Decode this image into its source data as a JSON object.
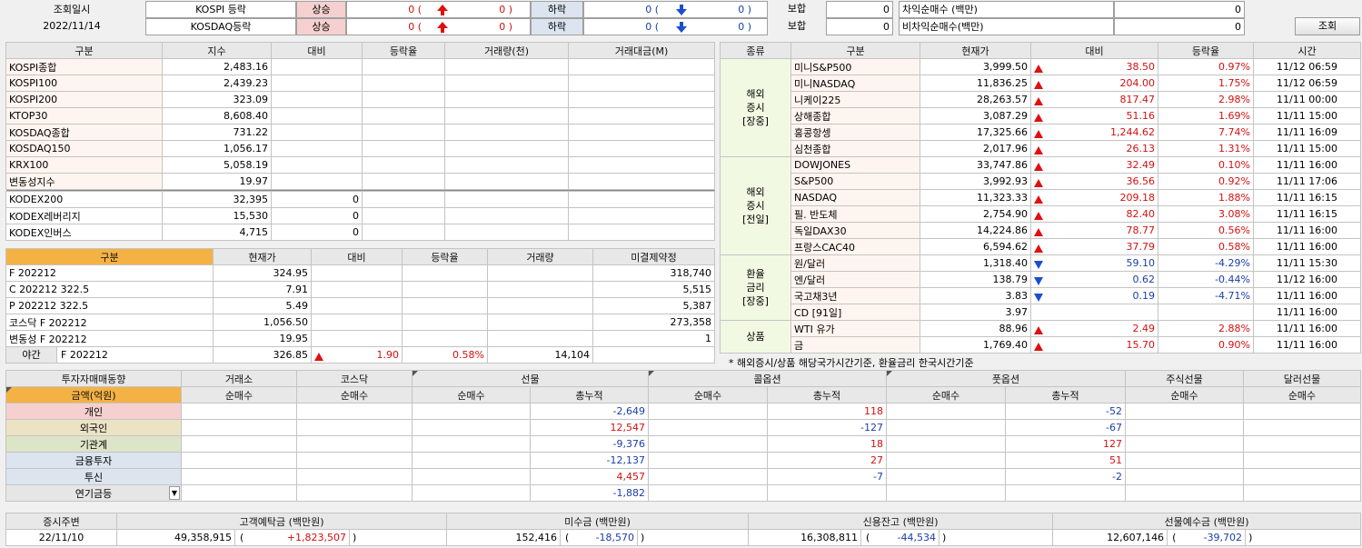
{
  "header": {
    "query_label": "조회일시",
    "query_date": "2022/11/14",
    "kospi_label": "KOSPI 등락",
    "kosdaq_label": "KOSDAQ등락",
    "up_label": "상승",
    "down_label": "하락",
    "flat_label": "보합",
    "kospi_up": "0 (",
    "kospi_up2": "0 )",
    "kospi_dn": "0 (",
    "kospi_dn2": "0 )",
    "kospi_flat": "0",
    "kosdaq_up": "0 (",
    "kosdaq_up2": "0 )",
    "kosdaq_dn": "0 (",
    "kosdaq_dn2": "0 )",
    "kosdaq_flat": "0",
    "arb_label": "차익순매수 (백만)",
    "arb_value": "0",
    "nonarb_label": "비차익순매수(백만)",
    "nonarb_value": "0",
    "search_button": "조회"
  },
  "index_table": {
    "headers": [
      "구분",
      "지수",
      "대비",
      "등락율",
      "거래량(천)",
      "거래대금(M)"
    ],
    "rows": [
      [
        "KOSPI종합",
        "2,483.16",
        "",
        "",
        "",
        ""
      ],
      [
        "KOSPI100",
        "2,439.23",
        "",
        "",
        "",
        ""
      ],
      [
        "KOSPI200",
        "323.09",
        "",
        "",
        "",
        ""
      ],
      [
        "KTOP30",
        "8,608.40",
        "",
        "",
        "",
        ""
      ],
      [
        "KOSDAQ종합",
        "731.22",
        "",
        "",
        "",
        ""
      ],
      [
        "KOSDAQ150",
        "1,056.17",
        "",
        "",
        "",
        ""
      ],
      [
        "KRX100",
        "5,058.19",
        "",
        "",
        "",
        ""
      ],
      [
        "변동성지수",
        "19.97",
        "",
        "",
        "",
        ""
      ]
    ],
    "etf_rows": [
      [
        "KODEX200",
        "32,395",
        "0",
        "",
        "",
        ""
      ],
      [
        "KODEX레버리지",
        "15,530",
        "0",
        "",
        "",
        ""
      ],
      [
        "KODEX인버스",
        "4,715",
        "0",
        "",
        "",
        ""
      ]
    ]
  },
  "futures_table": {
    "headers": [
      "구분",
      "현재가",
      "대비",
      "등락율",
      "거래량",
      "미결제약정"
    ],
    "rows": [
      [
        "F 202212",
        "324.95",
        "",
        "",
        "",
        "318,740"
      ],
      [
        "C 202212 322.5",
        "7.91",
        "",
        "",
        "",
        "5,515"
      ],
      [
        "P 202212 322.5",
        "5.49",
        "",
        "",
        "",
        "5,387"
      ],
      [
        "코스닥 F 202212",
        "1,056.50",
        "",
        "",
        "",
        "273,358"
      ],
      [
        "변동성 F 202212",
        "19.95",
        "",
        "",
        "",
        "1"
      ]
    ],
    "night": {
      "label": "야간",
      "name": "F 202212",
      "price": "326.85",
      "change": "1.90",
      "rate": "0.58%",
      "volume": "14,104"
    }
  },
  "overseas_table": {
    "headers": [
      "종류",
      "구분",
      "현재가",
      "대비",
      "등락율",
      "시간"
    ],
    "groups": [
      {
        "label": "해외\n증시\n[장중]",
        "rows": [
          {
            "name": "미니S&P500",
            "price": "3,999.50",
            "dir": "up",
            "change": "38.50",
            "rate": "0.97%",
            "time": "11/12 06:59"
          },
          {
            "name": "미니NASDAQ",
            "price": "11,836.25",
            "dir": "up",
            "change": "204.00",
            "rate": "1.75%",
            "time": "11/12 06:59"
          },
          {
            "name": "니케이225",
            "price": "28,263.57",
            "dir": "up",
            "change": "817.47",
            "rate": "2.98%",
            "time": "11/11 00:00"
          },
          {
            "name": "상해종합",
            "price": "3,087.29",
            "dir": "up",
            "change": "51.16",
            "rate": "1.69%",
            "time": "11/11 15:00"
          },
          {
            "name": "홍콩항셍",
            "price": "17,325.66",
            "dir": "up",
            "change": "1,244.62",
            "rate": "7.74%",
            "time": "11/11 16:09"
          },
          {
            "name": "심천종합",
            "price": "2,017.96",
            "dir": "up",
            "change": "26.13",
            "rate": "1.31%",
            "time": "11/11 15:00"
          }
        ]
      },
      {
        "label": "해외\n증시\n[전일]",
        "rows": [
          {
            "name": "DOWJONES",
            "price": "33,747.86",
            "dir": "up",
            "change": "32.49",
            "rate": "0.10%",
            "time": "11/11 16:00"
          },
          {
            "name": "S&P500",
            "price": "3,992.93",
            "dir": "up",
            "change": "36.56",
            "rate": "0.92%",
            "time": "11/11 17:06"
          },
          {
            "name": "NASDAQ",
            "price": "11,323.33",
            "dir": "up",
            "change": "209.18",
            "rate": "1.88%",
            "time": "11/11 16:15"
          },
          {
            "name": "필. 반도체",
            "price": "2,754.90",
            "dir": "up",
            "change": "82.40",
            "rate": "3.08%",
            "time": "11/11 16:15"
          },
          {
            "name": "독일DAX30",
            "price": "14,224.86",
            "dir": "up",
            "change": "78.77",
            "rate": "0.56%",
            "time": "11/11 16:00"
          },
          {
            "name": "프랑스CAC40",
            "price": "6,594.62",
            "dir": "up",
            "change": "37.79",
            "rate": "0.58%",
            "time": "11/11 16:00"
          }
        ]
      },
      {
        "label": "환율\n금리\n[장중]",
        "rows": [
          {
            "name": "원/달러",
            "price": "1,318.40",
            "dir": "dn",
            "change": "59.10",
            "rate": "-4.29%",
            "time": "11/11 15:30"
          },
          {
            "name": "엔/달러",
            "price": "138.79",
            "dir": "dn",
            "change": "0.62",
            "rate": "-0.44%",
            "time": "11/12 16:00"
          },
          {
            "name": "국고채3년",
            "price": "3.83",
            "dir": "dn",
            "change": "0.19",
            "rate": "-4.71%",
            "time": "11/11 16:00"
          },
          {
            "name": "CD [91일]",
            "price": "3.97",
            "dir": "",
            "change": "",
            "rate": "",
            "time": "11/11 16:00"
          }
        ]
      },
      {
        "label": "상품",
        "rows": [
          {
            "name": "WTI 유가",
            "price": "88.96",
            "dir": "up",
            "change": "2.49",
            "rate": "2.88%",
            "time": "11/11 16:00"
          },
          {
            "name": "금",
            "price": "1,769.40",
            "dir": "up",
            "change": "15.70",
            "rate": "0.90%",
            "time": "11/11 16:00"
          }
        ]
      }
    ],
    "footnote": "* 해외증시/상품 해당국가시간기준, 환율금리 한국시간기준"
  },
  "investor_table": {
    "title": "투자자매매동향",
    "unit": "금액(억원)",
    "top_headers": [
      "거래소",
      "코스닥",
      "선물",
      "콜옵션",
      "풋옵션",
      "주식선물",
      "달러선물"
    ],
    "sub_headers": [
      "순매수",
      "순매수",
      "순매수",
      "총누적",
      "순매수",
      "총누적",
      "순매수",
      "총누적",
      "순매수",
      "순매수"
    ],
    "rows": [
      {
        "name": "개인",
        "cls": "pink",
        "vals": [
          "",
          "",
          "",
          "-2,649",
          "",
          "118",
          "",
          "-52",
          "",
          ""
        ]
      },
      {
        "name": "외국인",
        "cls": "beige",
        "vals": [
          "",
          "",
          "",
          "12,547",
          "",
          "-127",
          "",
          "-67",
          "",
          ""
        ]
      },
      {
        "name": "기관계",
        "cls": "green",
        "vals": [
          "",
          "",
          "",
          "-9,376",
          "",
          "18",
          "",
          "127",
          "",
          ""
        ]
      },
      {
        "name": "금융투자",
        "cls": "blue1",
        "vals": [
          "",
          "",
          "",
          "-12,137",
          "",
          "27",
          "",
          "51",
          "",
          ""
        ]
      },
      {
        "name": "투신",
        "cls": "blue1",
        "vals": [
          "",
          "",
          "",
          "4,457",
          "",
          "-7",
          "",
          "-2",
          "",
          ""
        ]
      },
      {
        "name": "연기금등",
        "cls": "grey1",
        "vals": [
          "",
          "",
          "",
          "-1,882",
          "",
          "",
          "",
          "",
          "",
          ""
        ]
      }
    ]
  },
  "deposit_table": {
    "headers": [
      "증시주변",
      "고객예탁금 (백만원)",
      "미수금 (백만원)",
      "신용잔고 (백만원)",
      "선물예수금 (백만원)"
    ],
    "date": "22/11/10",
    "values": [
      {
        "v": "49,358,915",
        "d": "+1,823,507",
        "dir": "up"
      },
      {
        "v": "152,416",
        "d": "-18,570",
        "dir": "dn"
      },
      {
        "v": "16,308,811",
        "d": "-44,534",
        "dir": "dn"
      },
      {
        "v": "12,607,146",
        "d": "-39,702",
        "dir": "dn"
      }
    ],
    "open_paren": "(",
    "close_paren": ")"
  },
  "colors": {
    "up": "#d41010",
    "down": "#1a3fa8",
    "orange": "#f4b244"
  }
}
